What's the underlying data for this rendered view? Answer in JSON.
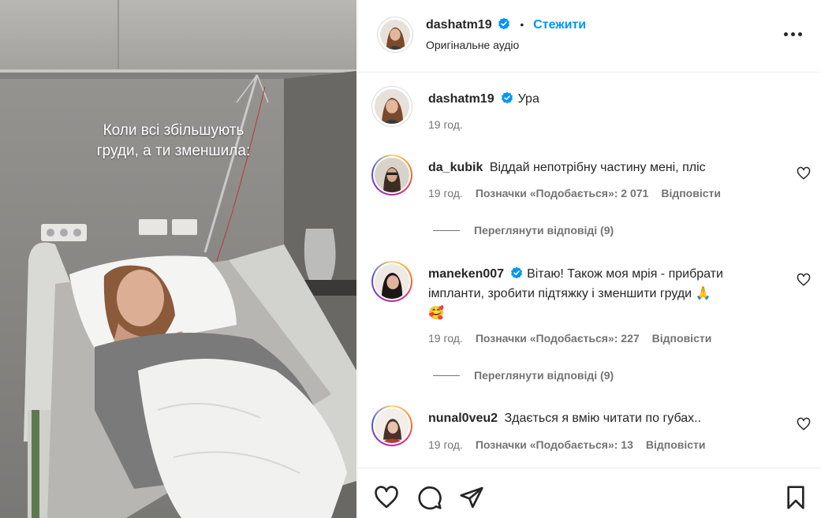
{
  "media": {
    "caption": "Коли всі збільшують\nгруди, а ти зменшила:"
  },
  "header": {
    "username": "dashatm19",
    "separator": "•",
    "follow_label": "Стежити",
    "audio": "Оригінальне аудіо",
    "more_icon": "more-horizontal-icon"
  },
  "post": {
    "username": "dashatm19",
    "text": "Ура",
    "time": "19 год."
  },
  "comments": [
    {
      "username": "da_kubik",
      "verified": false,
      "text": "Віддай непотрібну частину мені, пліс",
      "time": "19 год.",
      "likes": "Позначки «Подобається»: 2 071",
      "reply": "Відповісти",
      "view_replies": "Переглянути відповіді (9)"
    },
    {
      "username": "maneken007",
      "verified": true,
      "text": "Вітаю! Також моя мрія - прибрати імпланти, зробити підтяжку і зменшити груди",
      "emoji_1": "🙏",
      "emoji_2": "🥰",
      "time": "19 год.",
      "likes": "Позначки «Подобається»: 227",
      "reply": "Відповісти",
      "view_replies": "Переглянути відповіді (9)"
    },
    {
      "username": "nunal0veu2",
      "verified": false,
      "text": "Здається я вмію читати по губах..",
      "time": "19 год.",
      "likes": "Позначки «Подобається»: 13",
      "reply": "Відповісти"
    }
  ],
  "actions": {
    "like_icon": "heart-icon",
    "comment_icon": "comment-icon",
    "share_icon": "send-icon",
    "save_icon": "bookmark-icon"
  },
  "colors": {
    "accent": "#0095f6",
    "text": "#262626",
    "secondary": "#737373",
    "verified": "#0095f6"
  }
}
